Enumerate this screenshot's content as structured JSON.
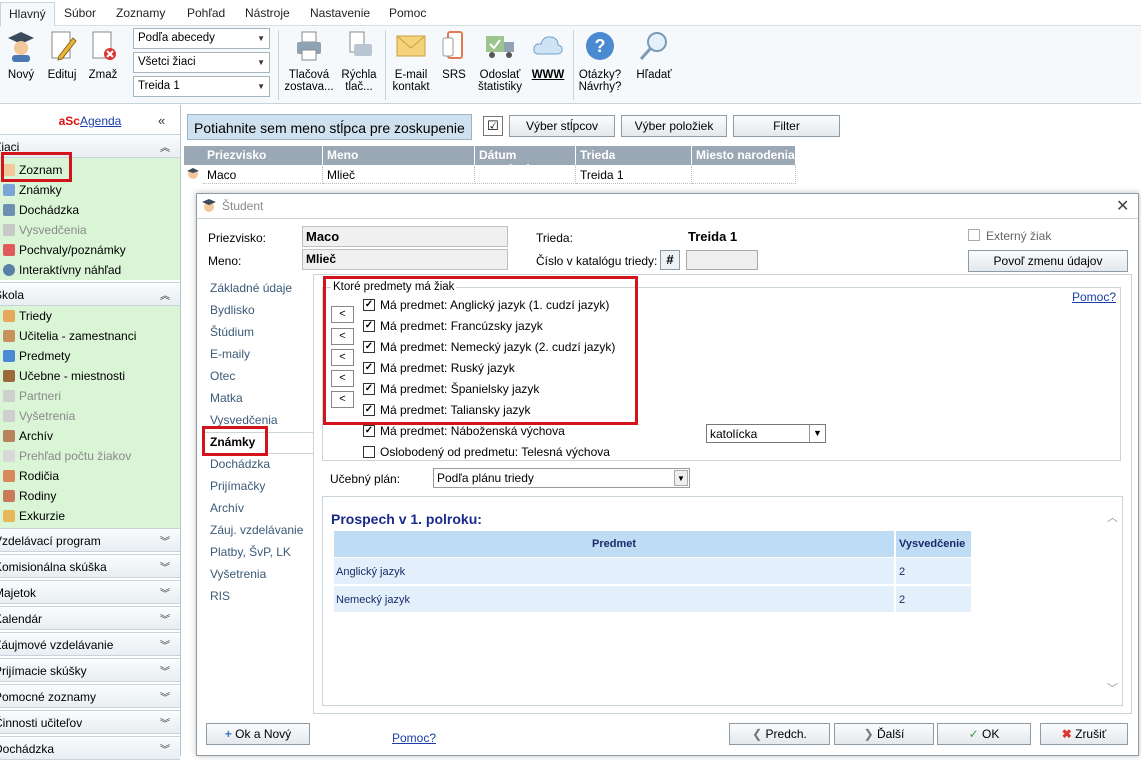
{
  "menu": {
    "tabs": [
      "Hlavný",
      "Súbor",
      "Zoznamy",
      "Pohľad",
      "Nástroje",
      "Nastavenie",
      "Pomoc"
    ]
  },
  "ribbon": {
    "new": "Nový",
    "edit": "Edituj",
    "delete": "Zmaž",
    "sort_select": "Podľa abecedy",
    "filter_select": "Všetci žiaci",
    "class_select": "Treida 1",
    "print_report": [
      "Tlačová",
      "zostava..."
    ],
    "quick_print": [
      "Rýchla",
      "tlač..."
    ],
    "email": [
      "E-mail",
      "kontakt"
    ],
    "srs": "SRS",
    "send_stats": [
      "Odoslať",
      "štatistiky"
    ],
    "www": "WWW",
    "questions": [
      "Otázky?",
      "Návrhy?"
    ],
    "search": "Hľadať"
  },
  "sidebar": {
    "brand_prefix": "aSc",
    "brand_suffix": "Agenda",
    "collapse": "«",
    "sections": [
      {
        "title": "Žiaci",
        "items": [
          {
            "label": "Zoznam",
            "disabled": false
          },
          {
            "label": "Známky",
            "disabled": false
          },
          {
            "label": "Dochádzka",
            "disabled": false
          },
          {
            "label": "Vysvedčenia",
            "disabled": true
          },
          {
            "label": "Pochvaly/poznámky",
            "disabled": false
          },
          {
            "label": "Interaktívny náhľad",
            "disabled": false
          }
        ]
      },
      {
        "title": "Škola",
        "items": [
          {
            "label": "Triedy",
            "disabled": false
          },
          {
            "label": "Učitelia - zamestnanci",
            "disabled": false
          },
          {
            "label": "Predmety",
            "disabled": false
          },
          {
            "label": "Učebne - miestnosti",
            "disabled": false
          },
          {
            "label": "Partneri",
            "disabled": true
          },
          {
            "label": "Vyšetrenia",
            "disabled": true
          },
          {
            "label": "Archív",
            "disabled": false
          },
          {
            "label": "Prehľad počtu žiakov",
            "disabled": true
          },
          {
            "label": "Rodičia",
            "disabled": false
          },
          {
            "label": "Rodiny",
            "disabled": false
          },
          {
            "label": "Exkurzie",
            "disabled": false
          }
        ]
      }
    ],
    "collapsed": [
      "Vzdelávací program",
      "Komisionálna skúška",
      "Majetok",
      "Kalendár",
      "Záujmové vzdelávanie",
      "Prijímacie skúšky",
      "Pomocné zoznamy",
      "Činnosti učiteľov",
      "Dochádzka"
    ]
  },
  "toolbar": {
    "group_hint": "Potiahnite sem meno stĺpca pre zoskupenie",
    "check": "☑",
    "columns_btn": "Výber stĺpcov",
    "items_btn": "Výber položiek",
    "filter_btn": "Filter"
  },
  "grid": {
    "headers": [
      "Priezvisko",
      "Meno",
      "Dátum narodenia",
      "Trieda",
      "Miesto narodenia"
    ],
    "rows": [
      [
        "Maco",
        "Mlieč",
        "",
        "Treida 1",
        ""
      ]
    ]
  },
  "dialog": {
    "title": "Študent",
    "surname_label": "Priezvisko:",
    "surname": "Maco",
    "name_label": "Meno:",
    "name": "Mlieč",
    "class_label": "Trieda:",
    "class_value": "Treida 1",
    "catalog_label": "Číslo v katalógu triedy:",
    "hash": "#",
    "external_label": "Externý žiak",
    "allow_edit_btn": "Povoľ zmenu údajov",
    "tabs": [
      "Základné údaje",
      "Bydlisko",
      "Štúdium",
      "E-maily",
      "Otec",
      "Matka",
      "Vysvedčenia",
      "Známky",
      "Dochádzka",
      "Prijímačky",
      "Archív",
      "Záuj. vzdelávanie",
      "Platby, ŠvP, LK",
      "Vyšetrenia",
      "RIS"
    ],
    "group_title": "Ktoré predmety má žiak",
    "help_link": "Pomoc?",
    "subjects": [
      "Má predmet: Anglický jazyk (1. cudzí jazyk)",
      "Má predmet: Francúzsky jazyk",
      "Má predmet: Nemecký jazyk (2. cudzí jazyk)",
      "Má predmet: Ruský jazyk",
      "Má predmet: Španielsky jazyk",
      "Má predmet: Taliansky jazyk",
      "Má predmet: Náboženská výchova"
    ],
    "arrow": "<",
    "religion_select": "katolícka",
    "exempt_label": "Oslobodený od predmetu: Telesná výchova",
    "plan_label": "Učebný plán:",
    "plan_select": "Podľa plánu triedy",
    "report_title": "Prospech v 1. polroku:",
    "report_headers": [
      "Predmet",
      "Vysvedčenie"
    ],
    "report_rows": [
      [
        "Anglický jazyk",
        "2"
      ],
      [
        "Nemecký jazyk",
        "2"
      ]
    ],
    "ok_new": "Ok a Nový",
    "help_bottom": "Pomoc?",
    "prev": "Predch.",
    "next": "Ďalší",
    "ok": "OK",
    "cancel": "Zrušiť"
  }
}
